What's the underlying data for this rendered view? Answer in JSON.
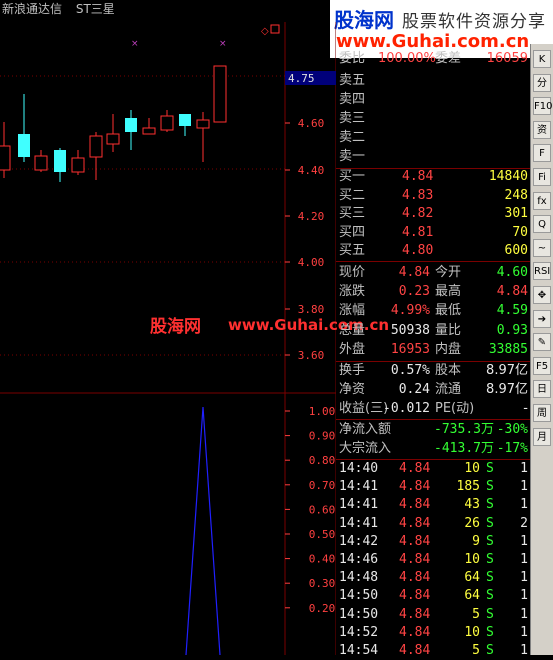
{
  "title": {
    "app": "新浪通达信",
    "stock": "ST三星"
  },
  "logo": {
    "brand": "股海网",
    "tagline": "股票软件资源分享",
    "url": "www.Guhai.com.cn"
  },
  "watermark": {
    "brand": "股海网",
    "url": "www.Guhai.com.cn"
  },
  "price_axis": [
    "4.75",
    "4.60",
    "4.40",
    "4.20",
    "4.00",
    "3.80",
    "3.60"
  ],
  "indicator_axis": [
    "1.00",
    "0.90",
    "0.80",
    "0.70",
    "0.60",
    "0.50",
    "0.40",
    "0.30",
    "0.20"
  ],
  "wb": {
    "label_ratio": "委比",
    "ratio": "100.00%",
    "label_diff": "委差",
    "diff": "16059"
  },
  "asks": [
    {
      "label": "卖五"
    },
    {
      "label": "卖四"
    },
    {
      "label": "卖三"
    },
    {
      "label": "卖二"
    },
    {
      "label": "卖一"
    }
  ],
  "bids": [
    {
      "label": "买一",
      "price": "4.84",
      "vol": "14840"
    },
    {
      "label": "买二",
      "price": "4.83",
      "vol": "248"
    },
    {
      "label": "买三",
      "price": "4.82",
      "vol": "301"
    },
    {
      "label": "买四",
      "price": "4.81",
      "vol": "70"
    },
    {
      "label": "买五",
      "price": "4.80",
      "vol": "600"
    }
  ],
  "stats": [
    {
      "l1": "现价",
      "v1": "4.84",
      "c1": "red",
      "l2": "今开",
      "v2": "4.60",
      "c2": "grn"
    },
    {
      "l1": "涨跌",
      "v1": "0.23",
      "c1": "red",
      "l2": "最高",
      "v2": "4.84",
      "c2": "red"
    },
    {
      "l1": "涨幅",
      "v1": "4.99%",
      "c1": "red",
      "l2": "最低",
      "v2": "4.59",
      "c2": "grn"
    },
    {
      "l1": "总量",
      "v1": "50938",
      "c1": "wht",
      "l2": "量比",
      "v2": "0.93",
      "c2": "grn"
    },
    {
      "l1": "外盘",
      "v1": "16953",
      "c1": "red",
      "l2": "内盘",
      "v2": "33885",
      "c2": "grn"
    }
  ],
  "fund": [
    {
      "l1": "换手",
      "v1": "0.57%",
      "l2": "股本",
      "v2": "8.97亿"
    },
    {
      "l1": "净资",
      "v1": "0.24",
      "l2": "流通",
      "v2": "8.97亿"
    },
    {
      "l1": "收益(三)",
      "v1": "-0.012",
      "l2": "PE(动)",
      "v2": "-"
    }
  ],
  "flow": [
    {
      "label": "净流入额",
      "amount": "-735.3万",
      "pct": "-30%"
    },
    {
      "label": "大宗流入",
      "amount": "-413.7万",
      "pct": "-17%"
    }
  ],
  "ticks": [
    {
      "time": "14:40",
      "price": "4.84",
      "vol": "10",
      "side": "S",
      "n": "1"
    },
    {
      "time": "14:41",
      "price": "4.84",
      "vol": "185",
      "side": "S",
      "n": "1"
    },
    {
      "time": "14:41",
      "price": "4.84",
      "vol": "43",
      "side": "S",
      "n": "1"
    },
    {
      "time": "14:41",
      "price": "4.84",
      "vol": "26",
      "side": "S",
      "n": "2"
    },
    {
      "time": "14:42",
      "price": "4.84",
      "vol": "9",
      "side": "S",
      "n": "1"
    },
    {
      "time": "14:46",
      "price": "4.84",
      "vol": "10",
      "side": "S",
      "n": "1"
    },
    {
      "time": "14:48",
      "price": "4.84",
      "vol": "64",
      "side": "S",
      "n": "1"
    },
    {
      "time": "14:50",
      "price": "4.84",
      "vol": "64",
      "side": "S",
      "n": "1"
    },
    {
      "time": "14:50",
      "price": "4.84",
      "vol": "5",
      "side": "S",
      "n": "1"
    },
    {
      "time": "14:52",
      "price": "4.84",
      "vol": "10",
      "side": "S",
      "n": "1"
    },
    {
      "time": "14:54",
      "price": "4.84",
      "vol": "5",
      "side": "S",
      "n": "1"
    }
  ],
  "toolbar": [
    "K",
    "分",
    "F10",
    "资",
    "F",
    "Fi",
    "fx",
    "Q",
    "~",
    "RSI",
    "✥",
    "➔",
    "✎",
    "F5",
    "日",
    "周",
    "月"
  ],
  "colors": {
    "up": "#ff3030",
    "down": "#40ffff",
    "grid": "#7a0000",
    "indicator": "#2020ff"
  }
}
